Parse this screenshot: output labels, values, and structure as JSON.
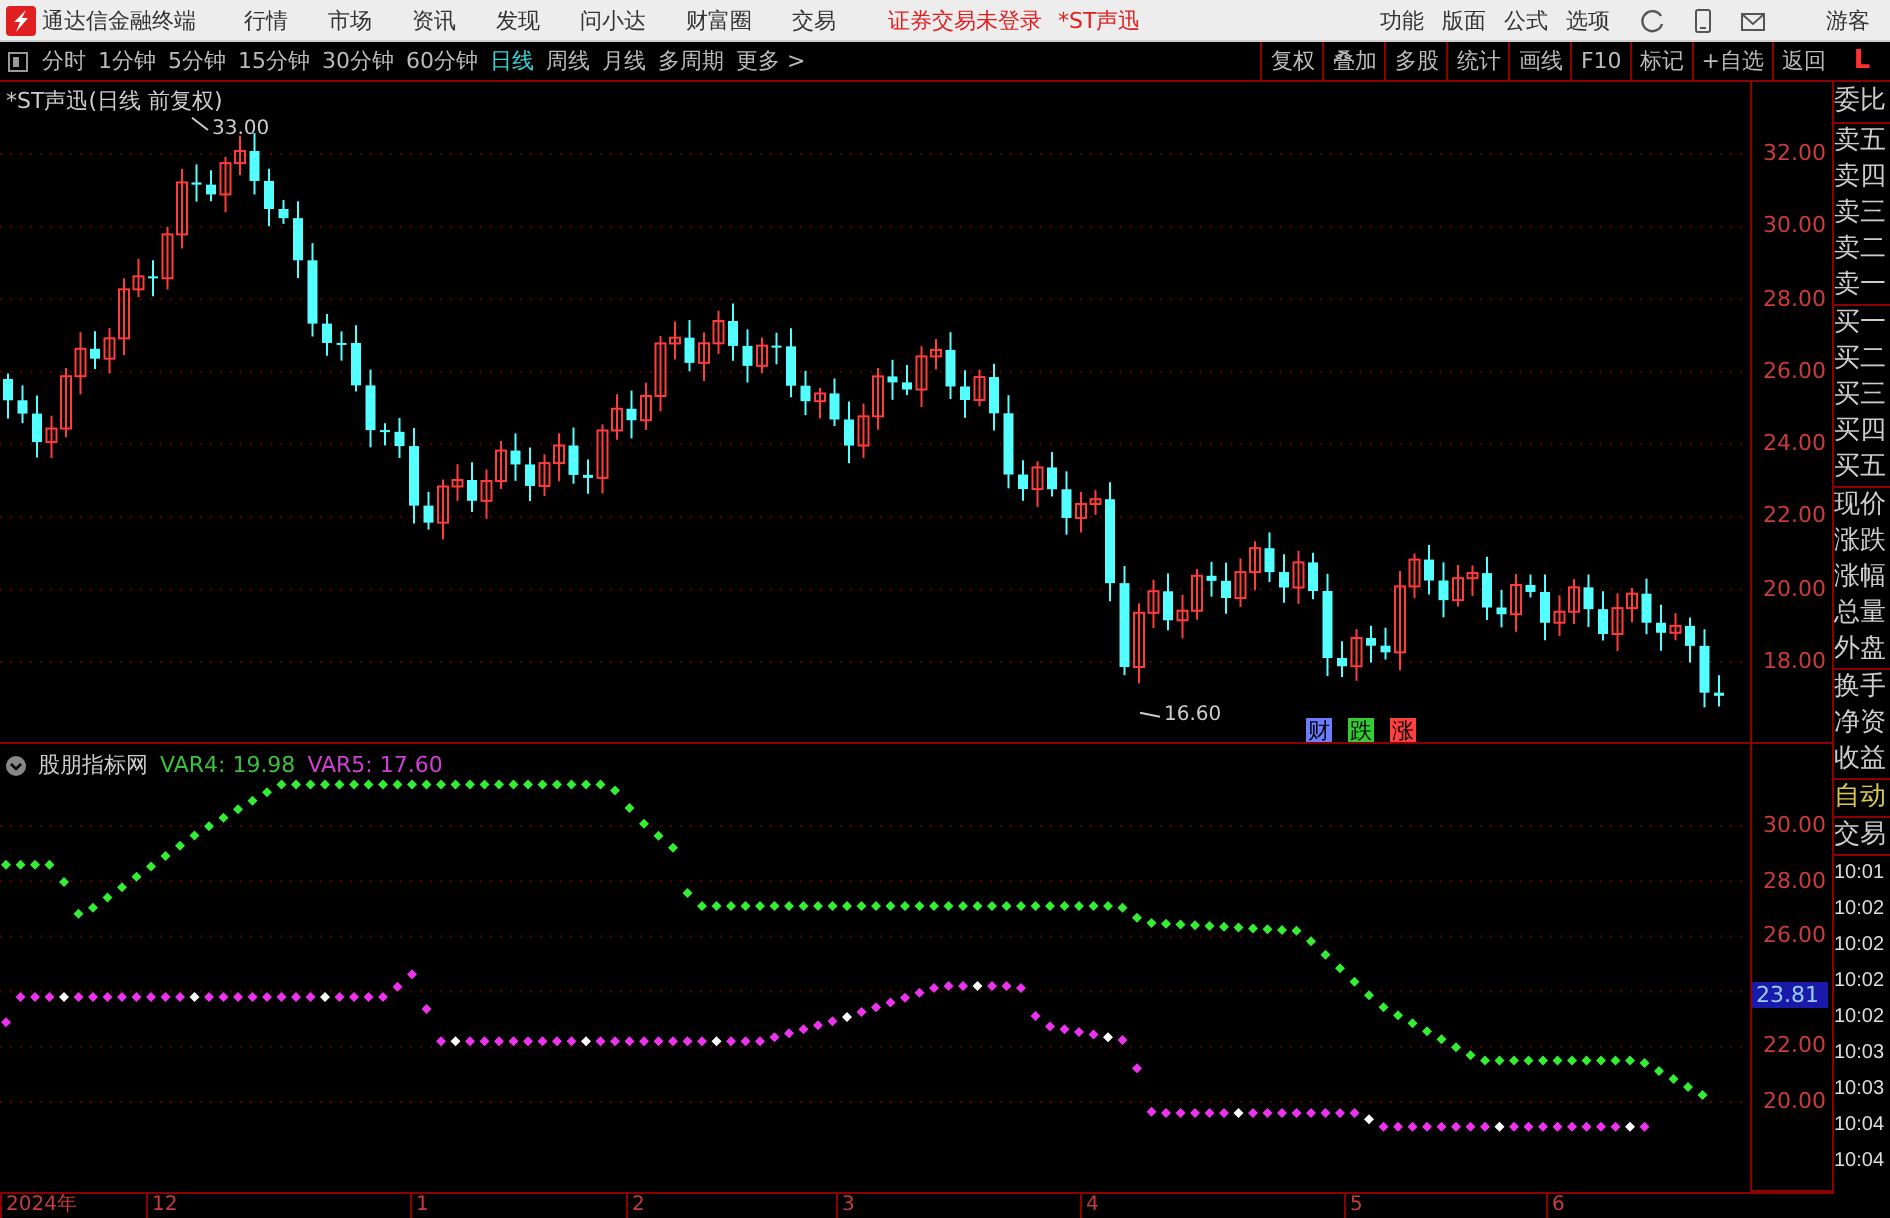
{
  "app": {
    "title": "通达信金融终端",
    "menu": [
      "行情",
      "市场",
      "资讯",
      "发现",
      "问小达",
      "财富圈",
      "交易"
    ],
    "status": "证券交易未登录",
    "stock": "*ST声迅",
    "tools": [
      "功能",
      "版面",
      "公式",
      "选项"
    ],
    "user": "游客"
  },
  "periods": [
    {
      "label": "分时",
      "selected": false
    },
    {
      "label": "1分钟",
      "selected": false
    },
    {
      "label": "5分钟",
      "selected": false
    },
    {
      "label": "15分钟",
      "selected": false
    },
    {
      "label": "30分钟",
      "selected": false
    },
    {
      "label": "60分钟",
      "selected": false
    },
    {
      "label": "日线",
      "selected": true
    },
    {
      "label": "周线",
      "selected": false
    },
    {
      "label": "月线",
      "selected": false
    },
    {
      "label": "多周期",
      "selected": false
    },
    {
      "label": "更多 >",
      "selected": false
    }
  ],
  "actions": [
    "复权",
    "叠加",
    "多股",
    "统计",
    "画线",
    "F10",
    "标记",
    "+自选",
    "返回"
  ],
  "layout_mark": "L",
  "price_chart": {
    "title": "*ST声迅(日线 前复权)",
    "high": "33.00",
    "low": "16.60",
    "signals": [
      {
        "text": "财",
        "color": "#6a7dff"
      },
      {
        "text": "跌",
        "color": "#33cc33"
      },
      {
        "text": "涨",
        "color": "#ff4040"
      }
    ],
    "yticks": [
      "32.00",
      "30.00",
      "28.00",
      "26.00",
      "24.00",
      "22.00",
      "20.00",
      "18.00"
    ]
  },
  "indicator": {
    "name": "股朋指标网",
    "var4": "VAR4: 19.98",
    "var5": "VAR5: 17.60",
    "yticks": [
      "30.00",
      "28.00",
      "26.00",
      "22.00",
      "20.00"
    ],
    "current_value": "23.81"
  },
  "time_axis": [
    "2024年",
    "12",
    "1",
    "2",
    "3",
    "4",
    "5",
    "6"
  ],
  "side_panel": {
    "sections": [
      [
        "委比"
      ],
      [
        "卖五",
        "卖四",
        "卖三",
        "卖二",
        "卖一"
      ],
      [
        "买一",
        "买二",
        "买三",
        "买四",
        "买五"
      ],
      [
        "现价",
        "涨跌",
        "涨幅",
        "总量",
        "外盘"
      ],
      [
        "换手",
        "净资",
        "收益"
      ]
    ],
    "mode": "自动",
    "trade_title": "交易",
    "times": [
      "10:01",
      "10:02",
      "10:02",
      "10:02",
      "10:02",
      "10:03",
      "10:03",
      "10:04",
      "10:04"
    ]
  }
}
